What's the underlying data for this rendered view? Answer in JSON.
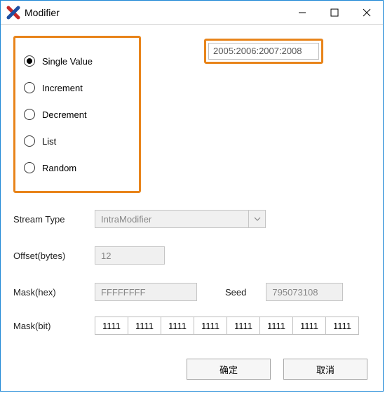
{
  "window": {
    "title": "Modifier"
  },
  "modifier_type": {
    "options": [
      {
        "label": "Single Value",
        "selected": true
      },
      {
        "label": "Increment",
        "selected": false
      },
      {
        "label": "Decrement",
        "selected": false
      },
      {
        "label": "List",
        "selected": false
      },
      {
        "label": "Random",
        "selected": false
      }
    ]
  },
  "value_display": "2005:2006:2007:2008",
  "labels": {
    "stream_type": "Stream Type",
    "offset": "Offset(bytes)",
    "mask_hex": "Mask(hex)",
    "seed": "Seed",
    "mask_bit": "Mask(bit)"
  },
  "stream_type": {
    "value": "IntraModifier",
    "disabled": true
  },
  "offset": {
    "value": "12",
    "disabled": true
  },
  "mask_hex": {
    "value": "FFFFFFFF",
    "disabled": true
  },
  "seed": {
    "value": "795073108",
    "disabled": true
  },
  "mask_bits": [
    "1111",
    "1111",
    "1111",
    "1111",
    "1111",
    "1111",
    "1111",
    "1111"
  ],
  "buttons": {
    "ok": "确定",
    "cancel": "取消"
  },
  "colors": {
    "highlight": "#e8841a",
    "window_border": "#1e88d6"
  }
}
